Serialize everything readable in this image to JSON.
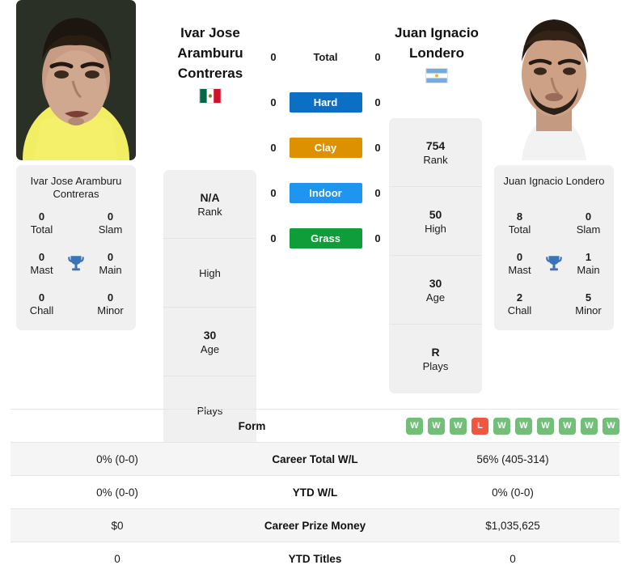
{
  "players": {
    "left": {
      "name_lines": [
        "Ivar Jose",
        "Aramburu",
        "Contreras"
      ],
      "card_name": "Ivar Jose Aramburu Contreras",
      "flag": "mexico-flag",
      "flag_name": "Mexico",
      "titles": {
        "total": "0",
        "total_label": "Total",
        "slam": "0",
        "slam_label": "Slam",
        "mast": "0",
        "mast_label": "Mast",
        "main": "0",
        "main_label": "Main",
        "chall": "0",
        "chall_label": "Chall",
        "minor": "0",
        "minor_label": "Minor"
      },
      "attributes": [
        {
          "value": "N/A",
          "label": "Rank"
        },
        {
          "value": "",
          "label": "High"
        },
        {
          "value": "30",
          "label": "Age"
        },
        {
          "value": "",
          "label": "Plays"
        }
      ],
      "surface_counts": {
        "total": "0",
        "hard": "0",
        "clay": "0",
        "indoor": "0",
        "grass": "0"
      }
    },
    "right": {
      "name_lines": [
        "Juan Ignacio",
        "Londero"
      ],
      "card_name": "Juan Ignacio Londero",
      "flag": "argentina-flag",
      "flag_name": "Argentina",
      "titles": {
        "total": "8",
        "total_label": "Total",
        "slam": "0",
        "slam_label": "Slam",
        "mast": "0",
        "mast_label": "Mast",
        "main": "1",
        "main_label": "Main",
        "chall": "2",
        "chall_label": "Chall",
        "minor": "5",
        "minor_label": "Minor"
      },
      "attributes": [
        {
          "value": "754",
          "label": "Rank"
        },
        {
          "value": "50",
          "label": "High"
        },
        {
          "value": "30",
          "label": "Age"
        },
        {
          "value": "R",
          "label": "Plays"
        }
      ],
      "surface_counts": {
        "total": "0",
        "hard": "0",
        "clay": "0",
        "indoor": "0",
        "grass": "0"
      }
    }
  },
  "surfaces": [
    {
      "key": "total",
      "label": "Total",
      "color": "transparent",
      "text_color": "#1b1b1b"
    },
    {
      "key": "hard",
      "label": "Hard",
      "color": "#0b6fc4",
      "text_color": "#ffffff"
    },
    {
      "key": "clay",
      "label": "Clay",
      "color": "#dd9000",
      "text_color": "#ffffff"
    },
    {
      "key": "indoor",
      "label": "Indoor",
      "color": "#1e95ef",
      "text_color": "#ffffff"
    },
    {
      "key": "grass",
      "label": "Grass",
      "color": "#0f9d3a",
      "text_color": "#ffffff"
    }
  ],
  "form": {
    "label": "Form",
    "results": [
      "W",
      "W",
      "W",
      "L",
      "W",
      "W",
      "W",
      "W",
      "W",
      "W"
    ]
  },
  "stats_rows": [
    {
      "label": "Career Total W/L",
      "left": "0% (0-0)",
      "right": "56% (405-314)"
    },
    {
      "label": "YTD W/L",
      "left": "0% (0-0)",
      "right": "0% (0-0)"
    },
    {
      "label": "Career Prize Money",
      "left": "$0",
      "right": "$1,035,625"
    },
    {
      "label": "YTD Titles",
      "left": "0",
      "right": "0"
    }
  ],
  "colors": {
    "win_badge": "#72c078",
    "loss_badge": "#f0573f",
    "card_bg": "#f0f0f0",
    "trophy": "#3a73b8"
  },
  "icons": {
    "trophy": "trophy-icon"
  }
}
